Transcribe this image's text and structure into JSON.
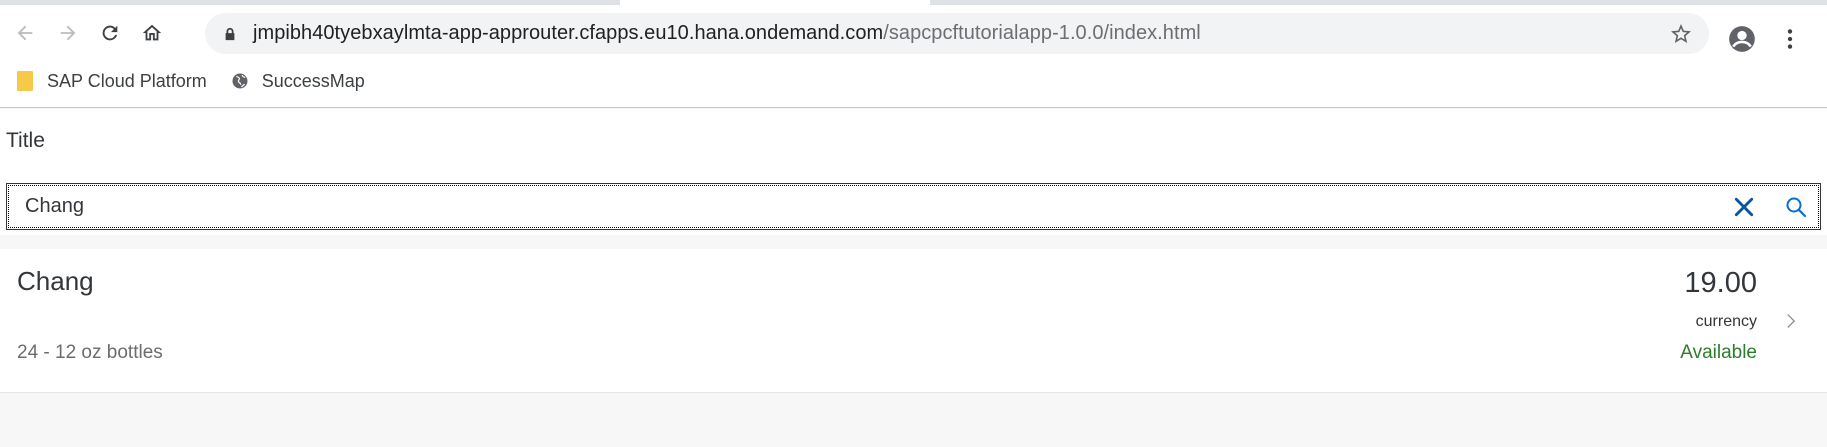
{
  "browser": {
    "url_host": "jmpibh40tyebxaylmta-app-approuter.cfapps.eu10.hana.ondemand.com",
    "url_path": "/sapcpcftutorialapp-1.0.0/index.html",
    "bookmarks": [
      {
        "label": "SAP Cloud Platform",
        "icon": "folder-icon"
      },
      {
        "label": "SuccessMap",
        "icon": "globe-icon"
      }
    ]
  },
  "page": {
    "title": "Title",
    "search": {
      "value": "Chang"
    },
    "items": [
      {
        "title": "Chang",
        "description": "24 - 12 oz bottles",
        "number": "19.00",
        "unit": "currency",
        "status": "Available"
      }
    ]
  },
  "colors": {
    "status_success": "#2b7d2b",
    "accent": "#0a6ed1",
    "folder": "#f7c948"
  }
}
